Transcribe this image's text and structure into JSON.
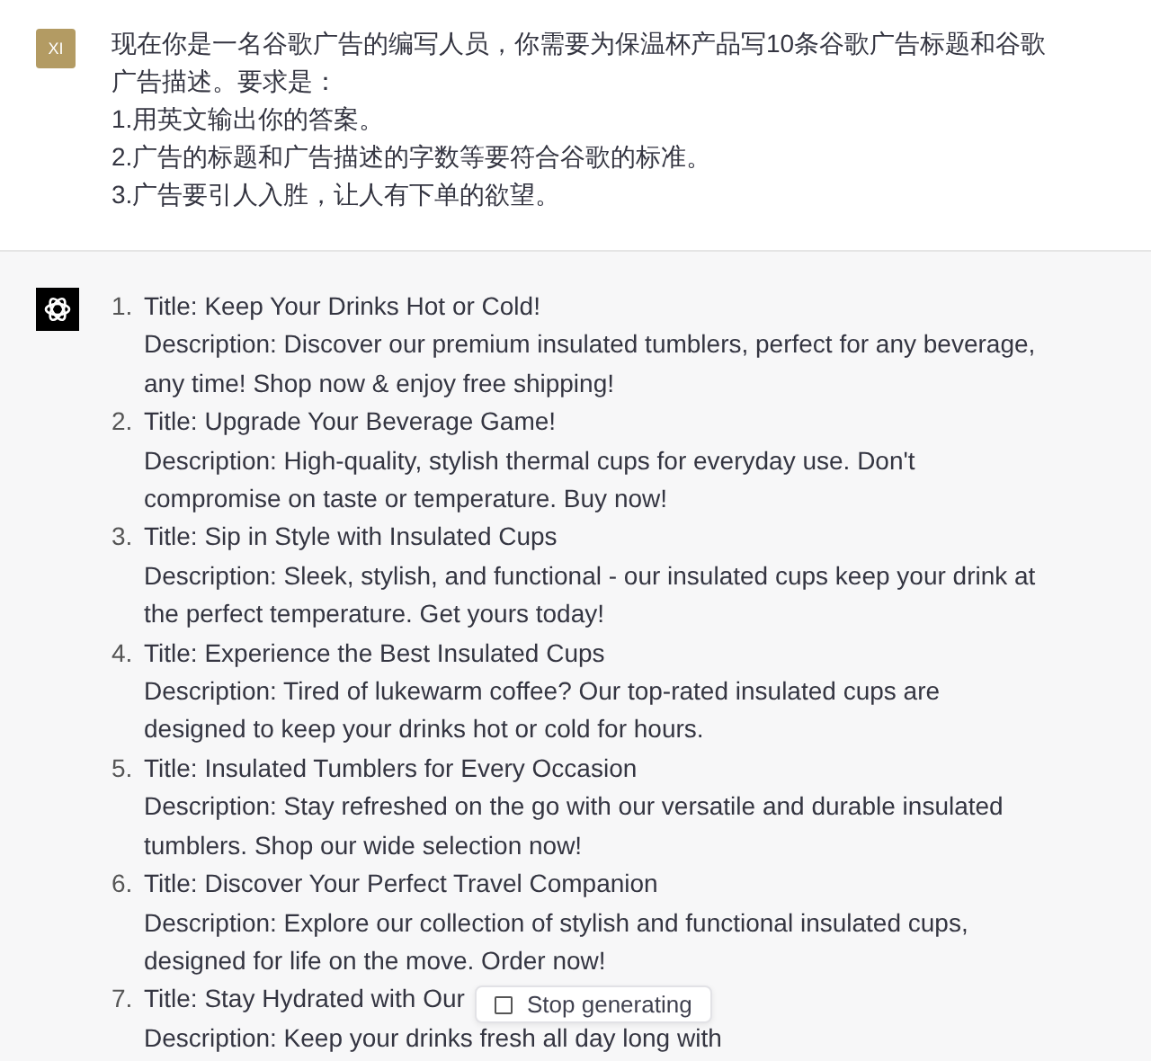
{
  "user_message": {
    "avatar": "XI",
    "lines": [
      "现在你是一名谷歌广告的编写人员，你需要为保温杯产品写10条谷歌广告标题和谷歌广告描述。要求是：",
      "1.用英文输出你的答案。",
      "2.广告的标题和广告描述的字数等要符合谷歌的标准。",
      "3.广告要引人入胜，让人有下单的欲望。"
    ]
  },
  "assistant_message": {
    "items": [
      {
        "number": "1.",
        "title": "Title: Keep Your Drinks Hot or Cold!",
        "description": "Description: Discover our premium insulated tumblers, perfect for any beverage, any time! Shop now & enjoy free shipping!"
      },
      {
        "number": "2.",
        "title": "Title: Upgrade Your Beverage Game!",
        "description": "Description: High-quality, stylish thermal cups for everyday use. Don't compromise on taste or temperature. Buy now!"
      },
      {
        "number": "3.",
        "title": "Title: Sip in Style with Insulated Cups",
        "description": "Description: Sleek, stylish, and functional - our insulated cups keep your drink at the perfect temperature. Get yours today!"
      },
      {
        "number": "4.",
        "title": "Title: Experience the Best Insulated Cups",
        "description": "Description: Tired of lukewarm coffee? Our top-rated insulated cups are designed to keep your drinks hot or cold for hours."
      },
      {
        "number": "5.",
        "title": "Title: Insulated Tumblers for Every Occasion",
        "description": "Description: Stay refreshed on the go with our versatile and durable insulated tumblers. Shop our wide selection now!"
      },
      {
        "number": "6.",
        "title": "Title: Discover Your Perfect Travel Companion",
        "description": "Description: Explore our collection of stylish and functional insulated cups, designed for life on the move. Order now!"
      },
      {
        "number": "7.",
        "title": "Title: Stay Hydrated with Our",
        "description": "Description: Keep your drinks fresh all day long with"
      }
    ]
  },
  "stop_button": {
    "label": "Stop generating"
  }
}
